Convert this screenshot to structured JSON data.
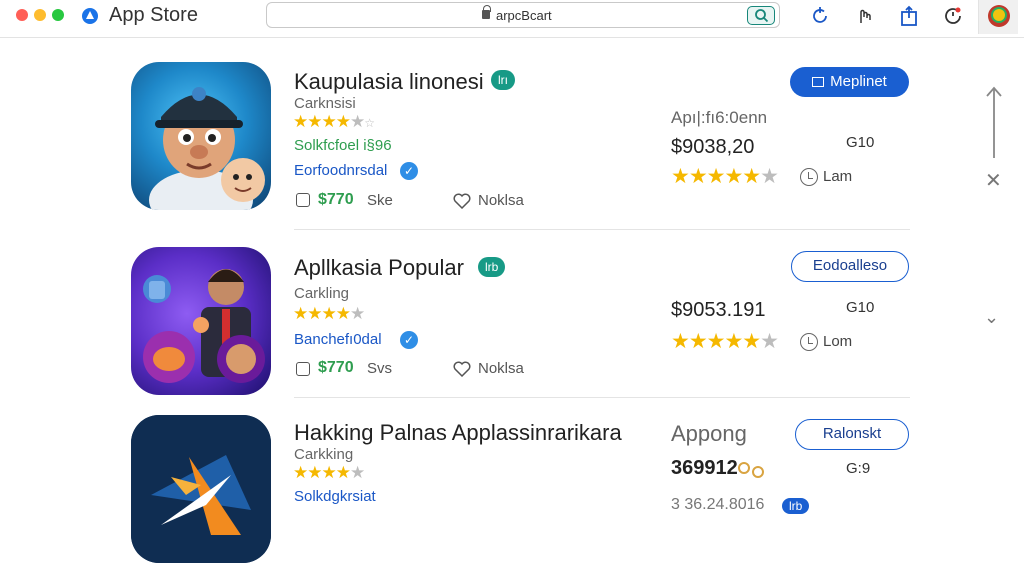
{
  "window": {
    "title": "App Store",
    "url": "arpcBcart"
  },
  "toolbar": {
    "icons": [
      "refresh-icon",
      "hand-icon",
      "share-icon",
      "history-icon"
    ]
  },
  "apps": [
    {
      "name": "Kaupulasia linonesi",
      "badge": "lrı",
      "category": "Carknsisi",
      "status": "Solkfcfoel i§96",
      "developer": "Eorfoodnrsdal",
      "price": "$770",
      "price_unit": "Ske",
      "like_label": "Noklsa",
      "date": "Apı|:fı6:0enn",
      "big_price": "$9038,20",
      "size": "G10",
      "rating": 4,
      "meta_rating": 4,
      "time_label": "Lam",
      "action": "Meplinet",
      "action_style": "primary",
      "icon_colors": [
        "#2a9fd6",
        "#0d3f6e"
      ]
    },
    {
      "name": "Apllkasia Popular",
      "badge": "lrb",
      "category": "Carkling",
      "status": "",
      "developer": "Banchefı0dal",
      "price": "$770",
      "price_unit": "Svs",
      "like_label": "Noklsa",
      "date": "",
      "big_price": "$9053.191",
      "size": "G10",
      "rating": 4,
      "meta_rating": 4,
      "time_label": "Lom",
      "action": "Eodoalleso",
      "action_style": "outline",
      "icon_colors": [
        "#5b2ec7",
        "#1c0f6b"
      ]
    },
    {
      "name": "Hakking Palnas Applassinrarikara",
      "badge": "",
      "category": "Carkking",
      "status": "",
      "developer": "Solkdgkrsiat",
      "price": "",
      "price_unit": "",
      "like_label": "",
      "date": "Appong",
      "big_price": "369912",
      "size": "G:9",
      "rating": 4,
      "meta_rating": 0,
      "time_label": "",
      "extra": "3 36.24.8016",
      "extra_badge": "lrb",
      "action": "Ralonskt",
      "action_style": "outline",
      "icon_colors": [
        "#14355e",
        "#0b1f3a"
      ]
    }
  ]
}
